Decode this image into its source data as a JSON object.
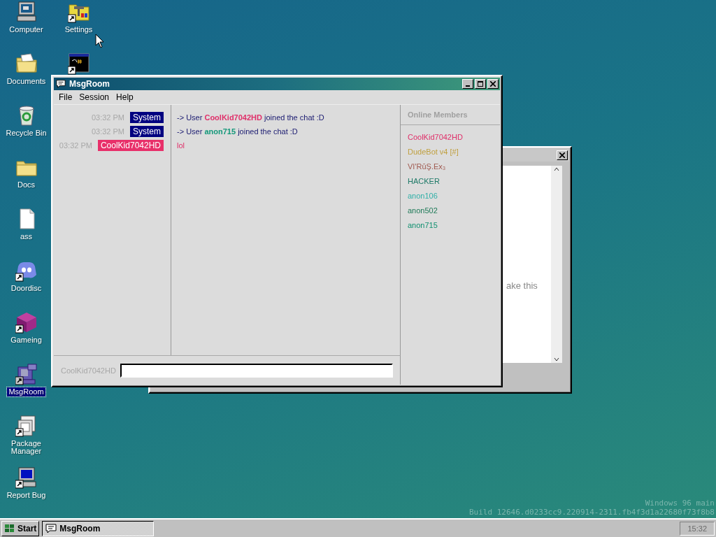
{
  "desktop_icons": [
    {
      "label": "Computer",
      "kind": "computer",
      "shortcut": false,
      "selected": false
    },
    {
      "label": "Documents",
      "kind": "documents",
      "shortcut": false,
      "selected": false
    },
    {
      "label": "Recycle Bin",
      "kind": "recycle",
      "shortcut": false,
      "selected": false
    },
    {
      "label": "Docs",
      "kind": "folder",
      "shortcut": false,
      "selected": false
    },
    {
      "label": "ass",
      "kind": "file",
      "shortcut": false,
      "selected": false
    },
    {
      "label": "Doordisc",
      "kind": "chatblob",
      "shortcut": true,
      "selected": false
    },
    {
      "label": "Gameing",
      "kind": "cube",
      "shortcut": true,
      "selected": false
    },
    {
      "label": "MsgRoom",
      "kind": "msgroom",
      "shortcut": true,
      "selected": true
    },
    {
      "label": "Package Manager",
      "kind": "package",
      "shortcut": true,
      "selected": false
    },
    {
      "label": "Report Bug",
      "kind": "bluescreen",
      "shortcut": true,
      "selected": false
    },
    {
      "label": "Settings",
      "kind": "settings",
      "shortcut": true,
      "selected": false
    },
    {
      "kind": "terminal",
      "shortcut": true,
      "selected": false
    }
  ],
  "background_window": {
    "active": false,
    "text": "ake this"
  },
  "window": {
    "title": "MsgRoom",
    "active": true,
    "menu": [
      "File",
      "Session",
      "Help"
    ],
    "messages": [
      {
        "kind": "join",
        "time": "03:32 PM",
        "sender": {
          "name": "System",
          "color": "#000080"
        },
        "prefix": "-> User",
        "user": {
          "name": "CoolKid7042HD",
          "color": "#e0306a"
        },
        "suffix": "joined the chat :D"
      },
      {
        "kind": "join",
        "time": "03:32 PM",
        "sender": {
          "name": "System",
          "color": "#000080"
        },
        "prefix": "-> User",
        "user": {
          "name": "anon715",
          "color": "#14987a"
        },
        "suffix": "joined the chat :D"
      },
      {
        "kind": "chat",
        "time": "03:32 PM",
        "sender": {
          "name": "CoolKid7042HD",
          "color": "#e8306a"
        },
        "body": {
          "text": "lol",
          "color": "#e0306a"
        }
      }
    ],
    "members_title": "Online Members",
    "members": [
      {
        "name": "CoolKid7042HD",
        "color": "#e0306a"
      },
      {
        "name": "DudeBot v4 [#]",
        "color": "#c0a040"
      },
      {
        "name": "VI'RūŞ.Ex₃",
        "color": "#a05a50"
      },
      {
        "name": "HACKER",
        "color": "#1f7a68"
      },
      {
        "name": "anon106",
        "color": "#30b0a8"
      },
      {
        "name": "anon502",
        "color": "#1f7a58"
      },
      {
        "name": "anon715",
        "color": "#119070"
      }
    ],
    "input_label": "CoolKid7042HD"
  },
  "build_info": [
    "Windows 96 main",
    "Build 12646.d0233cc9.220914-2311.fb4f3d1a22680f73f8b8"
  ],
  "taskbar": {
    "start": "Start",
    "tasks": [
      {
        "label": "MsgRoom",
        "selected": true
      }
    ],
    "clock": "15:32"
  }
}
